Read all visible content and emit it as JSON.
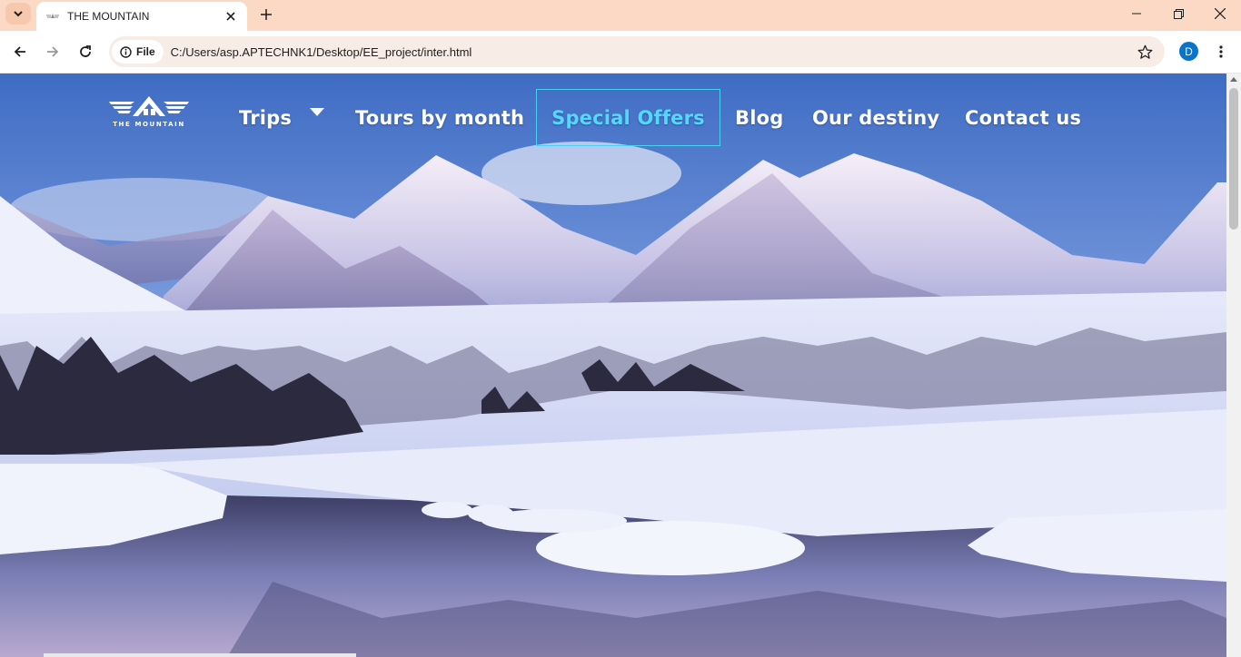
{
  "browser": {
    "tab_title": "THE MOUNTAIN",
    "site_chip": "File",
    "url": "C:/Users/asp.APTECHNK1/Desktop/EE_project/inter.html",
    "profile_initial": "D"
  },
  "site": {
    "logo_text": "THE MOUNTAIN",
    "nav": [
      {
        "label": "Trips",
        "has_dropdown": true
      },
      {
        "label": "Tours by month"
      },
      {
        "label": "Special Offers",
        "active": true
      },
      {
        "label": "Blog"
      },
      {
        "label": "Our destiny"
      },
      {
        "label": "Contact us"
      }
    ],
    "active_color": "#54d8ff"
  },
  "icons": {
    "tab_search": "chevron-down-icon",
    "tab_close": "close-icon",
    "new_tab": "plus-icon",
    "back": "arrow-left-icon",
    "forward": "arrow-right-icon",
    "reload": "reload-icon",
    "info": "info-icon",
    "bookmark": "star-icon",
    "menu": "kebab-icon"
  }
}
